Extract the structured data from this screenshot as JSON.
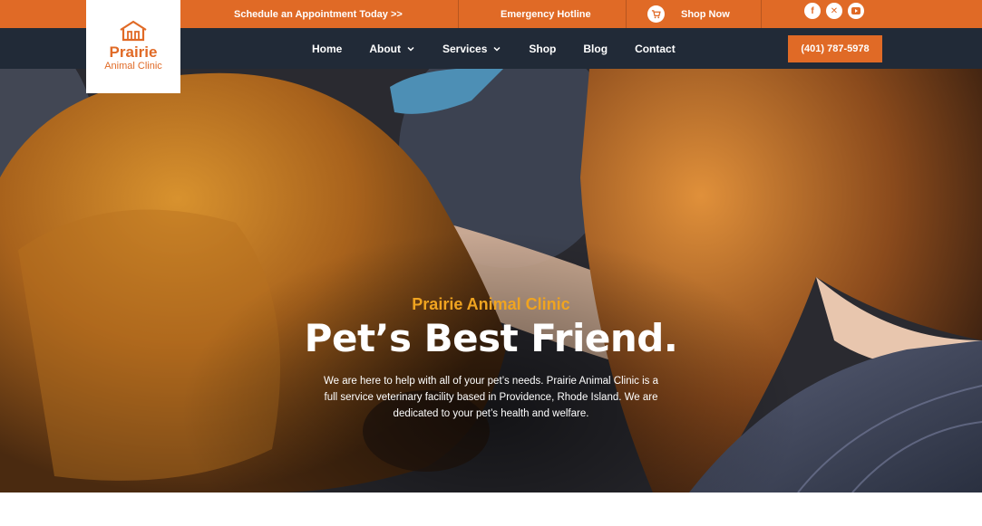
{
  "topbar": {
    "appointment_text": "Schedule an Appointment Today >>",
    "hotline_text": "Emergency Hotline",
    "shop_text": "Shop Now",
    "social_icons": [
      "facebook-icon",
      "x-icon",
      "youtube-icon"
    ]
  },
  "logo": {
    "name": "Prairie",
    "subtitle": "Animal Clinic"
  },
  "nav": {
    "items": [
      {
        "label": "Home",
        "dropdown": false
      },
      {
        "label": "About",
        "dropdown": true
      },
      {
        "label": "Services",
        "dropdown": true
      },
      {
        "label": "Shop",
        "dropdown": false
      },
      {
        "label": "Blog",
        "dropdown": false
      },
      {
        "label": "Contact",
        "dropdown": false
      }
    ],
    "phone": "(401) 787-5978"
  },
  "hero": {
    "kicker": "Prairie Animal Clinic",
    "title": "Pet’s Best Friend.",
    "description": "We are here to help with all of your pet’s needs. Prairie Animal Clinic is a full service veterinary facility based in Providence, Rhode Island. We are dedicated to your pet’s health and welfare."
  },
  "colors": {
    "accent": "#e06a26",
    "nav_bg": "#212a37",
    "kicker": "#f0a420"
  }
}
